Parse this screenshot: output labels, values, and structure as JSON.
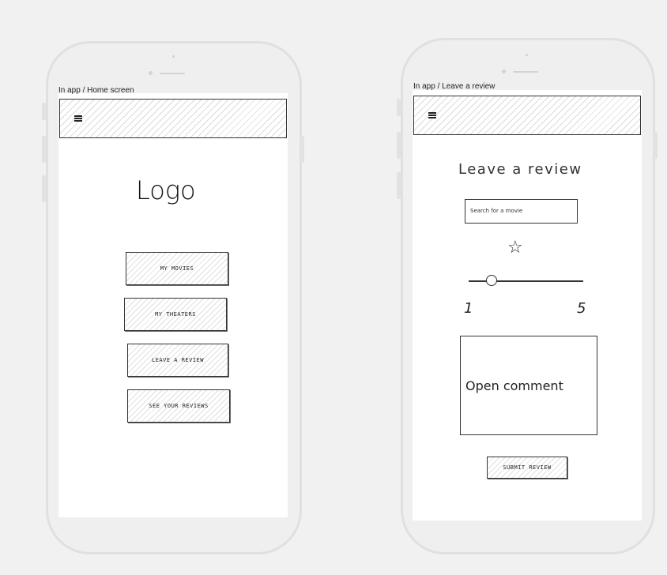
{
  "frames": [
    {
      "label": "In app / Home screen",
      "menu_icon": "hamburger-menu-icon",
      "logo": "Logo",
      "buttons": [
        "MY MOVIES",
        "MY THEATERS",
        "LEAVE A REVIEW",
        "SEE YOUR REVIEWS"
      ]
    },
    {
      "label": "In app / Leave a review",
      "menu_icon": "hamburger-menu-icon",
      "title": "Leave a review",
      "search_placeholder": "Search for a movie",
      "rating_icon": "star-icon",
      "slider_min": "1",
      "slider_max": "5",
      "slider_value": 0.2,
      "comment_placeholder": "Open comment",
      "submit_label": "SUBMIT REVIEW"
    }
  ],
  "colors": {
    "background": "#f1f1f1",
    "phone": "#efefef",
    "ink": "#333333"
  }
}
